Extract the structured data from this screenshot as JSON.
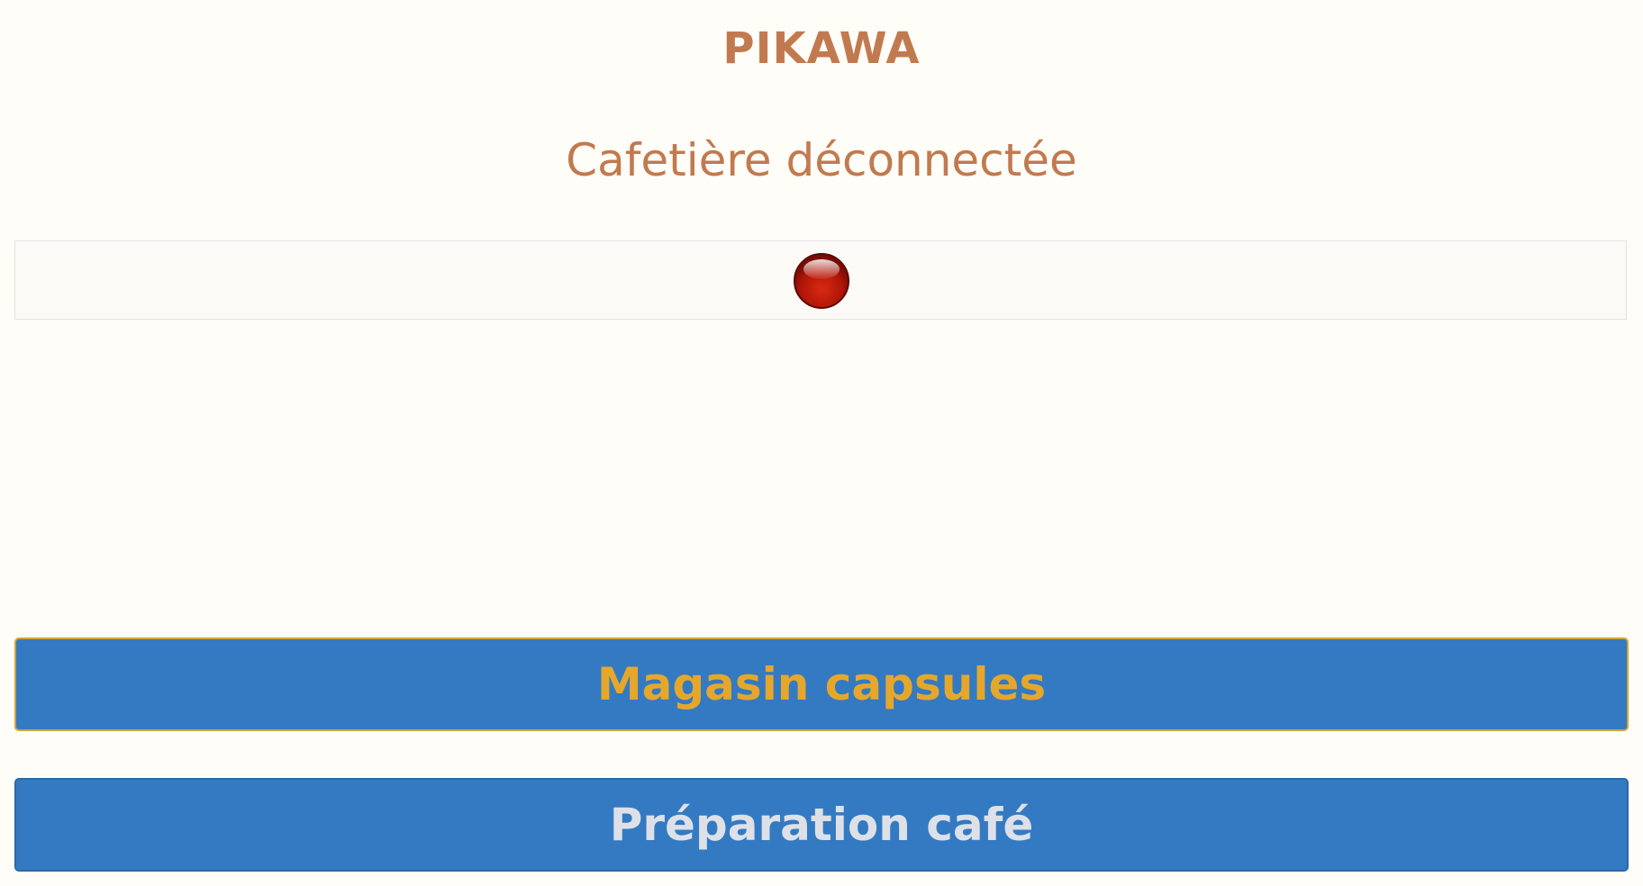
{
  "header": {
    "title": "PIKAWA"
  },
  "status": {
    "text": "Cafetière déconnectée",
    "indicator": "red-status-light-icon",
    "indicator_color": "#c4170d"
  },
  "buttons": {
    "capsules_label": "Magasin capsules",
    "preparation_label": "Préparation café"
  },
  "colors": {
    "background": "#fffdf7",
    "title": "#c17a4f",
    "button": "#337ac2",
    "capsules_text": "#e5a72b",
    "preparation_text": "#dde1e7"
  }
}
